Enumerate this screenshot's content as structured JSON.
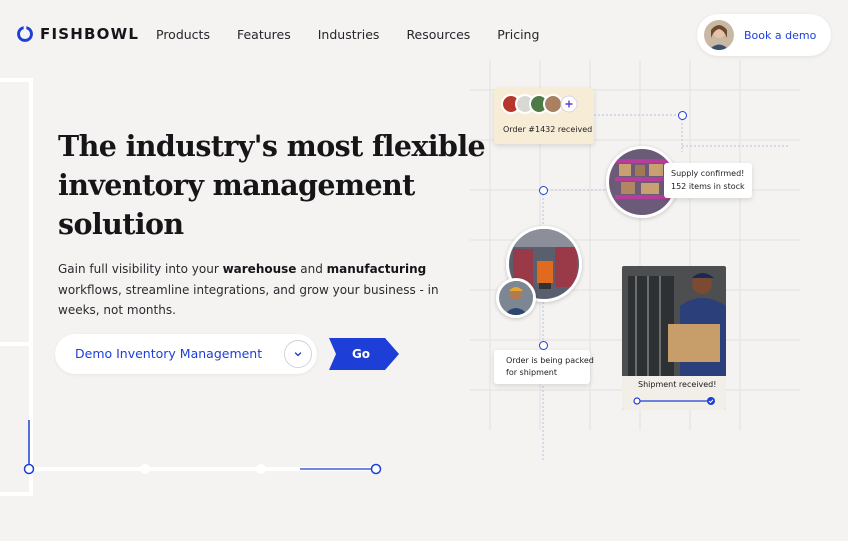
{
  "brand": {
    "name": "FISHBOWL",
    "accent": "#1d3fd8"
  },
  "nav": {
    "items": [
      {
        "label": "Products"
      },
      {
        "label": "Features"
      },
      {
        "label": "Industries"
      },
      {
        "label": "Resources"
      },
      {
        "label": "Pricing"
      }
    ],
    "cta_label": "Book a demo"
  },
  "hero": {
    "headline_lines": [
      "The industry's most flexible",
      "inventory management",
      "solution"
    ],
    "sub_line1_a": "Gain full visibility into your ",
    "sub_line1_b": "warehouse",
    "sub_line1_c": " and ",
    "sub_line1_d": "manufacturing",
    "sub_line2": "workflows, streamline integrations, and grow your business - in",
    "sub_line3": "weeks, not months.",
    "select_value": "Demo Inventory Management",
    "go_label": "Go"
  },
  "illustration": {
    "order_card": "Order #1432 received",
    "supply_line1": "Supply confirmed!",
    "supply_line2": "152 items in stock",
    "packing_line1": "Order is being packed",
    "packing_line2": "for shipment",
    "shipment_label": "Shipment received!",
    "icons": [
      "plus-icon",
      "check-icon",
      "chevron-down-icon"
    ]
  }
}
